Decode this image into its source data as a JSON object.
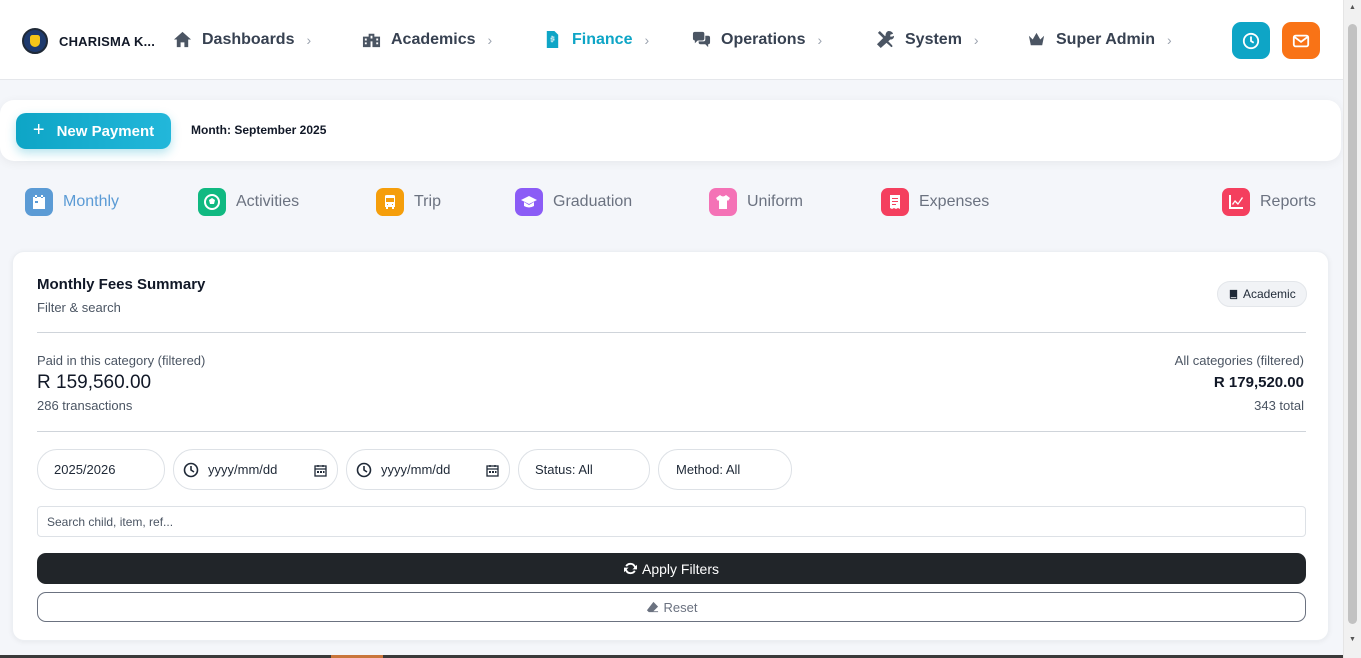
{
  "brand": {
    "name": "CHARISMA K..."
  },
  "nav": [
    {
      "label": "Dashboards",
      "icon": "home-icon"
    },
    {
      "label": "Academics",
      "icon": "school-icon"
    },
    {
      "label": "Finance",
      "icon": "invoice-icon",
      "active": true
    },
    {
      "label": "Operations",
      "icon": "chat-icon"
    },
    {
      "label": "System",
      "icon": "tools-icon"
    },
    {
      "label": "Super Admin",
      "icon": "crown-icon"
    }
  ],
  "top_buttons": {
    "clock_color": "#0ea5c6",
    "mail_color": "#f97316"
  },
  "actionbar": {
    "new_payment": "New Payment",
    "month": "Month: September 2025"
  },
  "categories": [
    {
      "label": "Monthly",
      "icon": "calendar-icon",
      "color": "#5b9bd5",
      "active": true
    },
    {
      "label": "Activities",
      "icon": "football-icon",
      "color": "#10b981"
    },
    {
      "label": "Trip",
      "icon": "bus-icon",
      "color": "#f59e0b"
    },
    {
      "label": "Graduation",
      "icon": "graduation-cap-icon",
      "color": "#8b5cf6"
    },
    {
      "label": "Uniform",
      "icon": "shirt-icon",
      "color": "#f472b6"
    },
    {
      "label": "Expenses",
      "icon": "receipt-icon",
      "color": "#f43f5e"
    },
    {
      "label": "Reports",
      "icon": "chart-line-icon",
      "color": "#f43f5e"
    }
  ],
  "summary": {
    "title": "Monthly Fees Summary",
    "subtitle": "Filter & search",
    "badge": "Academic",
    "paid_label": "Paid in this category (filtered)",
    "paid_amount": "R 159,560.00",
    "paid_count": "286 transactions",
    "all_label": "All categories (filtered)",
    "all_amount": "R 179,520.00",
    "all_count": "343 total"
  },
  "filters": {
    "year": "2025/2026",
    "date_from": "yyyy/mm/dd",
    "date_to": "yyyy/mm/dd",
    "status": "Status: All",
    "method": "Method: All",
    "search_placeholder": "Search child, item, ref...",
    "apply": "Apply Filters",
    "reset": "Reset"
  }
}
